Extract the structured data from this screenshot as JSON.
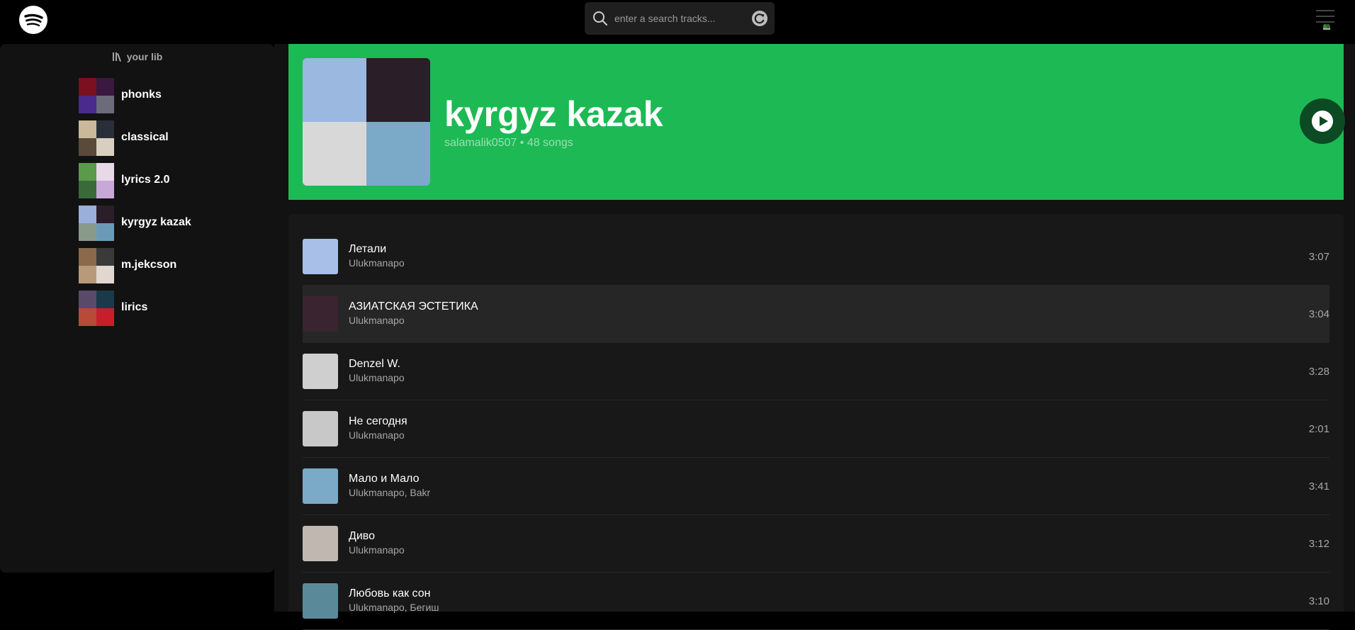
{
  "app": {
    "logo_icon": "spotify-logo-icon"
  },
  "search": {
    "placeholder": "enter a search tracks...",
    "value": "",
    "icon": "search-icon",
    "action_icon": "refresh-icon"
  },
  "sidebar": {
    "title": "your lib",
    "icon": "library-icon",
    "items": [
      {
        "label": "phonks",
        "colors": [
          "#7a1020",
          "#3a1840",
          "#4a2a8a",
          "#6b6b7a"
        ]
      },
      {
        "label": "classical",
        "colors": [
          "#c9b89a",
          "#2a2e3a",
          "#5a4a3a",
          "#d8cfc0"
        ]
      },
      {
        "label": "lyrics 2.0",
        "colors": [
          "#5a9a4a",
          "#e8d8e8",
          "#3a6a3a",
          "#c8a8d8"
        ]
      },
      {
        "label": "kyrgyz kazak",
        "colors": [
          "#9ab0d8",
          "#2a1e28",
          "#8a9a8a",
          "#6a9ab8"
        ]
      },
      {
        "label": "m.jekcson",
        "colors": [
          "#8a6a4a",
          "#3a3a3a",
          "#b89a7a",
          "#e0d8d0"
        ]
      },
      {
        "label": "lirics",
        "colors": [
          "#5a4a6a",
          "#1a3a4a",
          "#b84a3a",
          "#c81e2a"
        ]
      }
    ]
  },
  "playlist": {
    "title": "kyrgyz kazak",
    "owner": "salamalik0507",
    "separator": "•",
    "count": "48 songs",
    "accent": "#1db954",
    "play_icon": "play-icon",
    "cover_colors": [
      "#9ab8e0",
      "#2a1e28",
      "#d8d8d8",
      "#7aaac8"
    ]
  },
  "tracks": [
    {
      "title": "Летали",
      "artist": "Ulukmanapo",
      "duration": "3:07",
      "color": "#a8c0e8"
    },
    {
      "title": "АЗИАТСКАЯ ЭСТЕТИКА",
      "artist": "Ulukmanapo",
      "duration": "3:04",
      "color": "#3a2430",
      "highlight": true
    },
    {
      "title": "Denzel W.",
      "artist": "Ulukmanapo",
      "duration": "3:28",
      "color": "#cfcfcf"
    },
    {
      "title": "Не сегодня",
      "artist": "Ulukmanapo",
      "duration": "2:01",
      "color": "#c8c8c8"
    },
    {
      "title": "Мало и Мало",
      "artist": "Ulukmanapo, Bakr",
      "duration": "3:41",
      "color": "#7aaac8"
    },
    {
      "title": "Диво",
      "artist": "Ulukmanapo",
      "duration": "3:12",
      "color": "#c0b8b0"
    },
    {
      "title": "Любовь как сон",
      "artist": "Ulukmanapo, Бегиш",
      "duration": "3:10",
      "color": "#5a8a9a"
    }
  ]
}
